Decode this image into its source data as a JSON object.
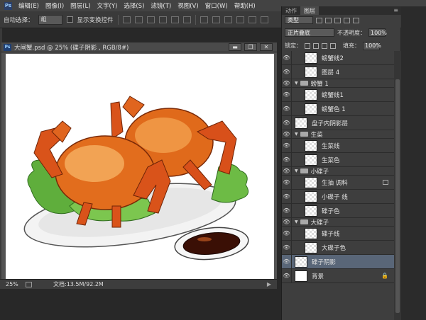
{
  "menu": {
    "items": [
      "编辑(E)",
      "图像(I)",
      "图层(L)",
      "文字(Y)",
      "选择(S)",
      "滤镜(T)",
      "视图(V)",
      "窗口(W)",
      "帮助(H)"
    ]
  },
  "options": {
    "auto_select_label": "自动选择：",
    "auto_select_value": "组",
    "show_transform_label": "显示变换控件"
  },
  "document": {
    "title": "大闸蟹.psd @ 25% (碟子阴影 , RGB/8#)",
    "minimize": "▬",
    "maximize": "❐",
    "close": "✕",
    "zoom": "25%",
    "doc_size": "文档:13.5M/92.2M"
  },
  "panel": {
    "tabs": [
      "动作",
      "图层"
    ],
    "filter_type": "类型",
    "blend_mode": "正片叠底",
    "opacity_label": "不透明度：",
    "opacity_value": "100%",
    "lock_label": "锁定：",
    "fill_label": "填充：",
    "fill_value": "100%"
  },
  "layers": [
    {
      "name": "螃蟹线2",
      "kind": "layer"
    },
    {
      "name": "图层 4",
      "kind": "layer"
    },
    {
      "name": "螃蟹 1",
      "kind": "group"
    },
    {
      "name": "螃蟹线1",
      "kind": "layer"
    },
    {
      "name": "螃蟹色 1",
      "kind": "layer"
    },
    {
      "name": "盘子内阴影层",
      "kind": "layer"
    },
    {
      "name": "生菜",
      "kind": "group"
    },
    {
      "name": "生菜线",
      "kind": "layer"
    },
    {
      "name": "生菜色",
      "kind": "layer"
    },
    {
      "name": "小碟子",
      "kind": "group"
    },
    {
      "name": "生抽 调料",
      "kind": "layer"
    },
    {
      "name": "小碟子 线",
      "kind": "layer"
    },
    {
      "name": "碟子色",
      "kind": "layer"
    },
    {
      "name": "大碟子",
      "kind": "group"
    },
    {
      "name": "碟子线",
      "kind": "layer"
    },
    {
      "name": "大碟子色",
      "kind": "layer"
    },
    {
      "name": "碟子阴影",
      "kind": "layer",
      "selected": true
    },
    {
      "name": "背景",
      "kind": "background"
    }
  ]
}
